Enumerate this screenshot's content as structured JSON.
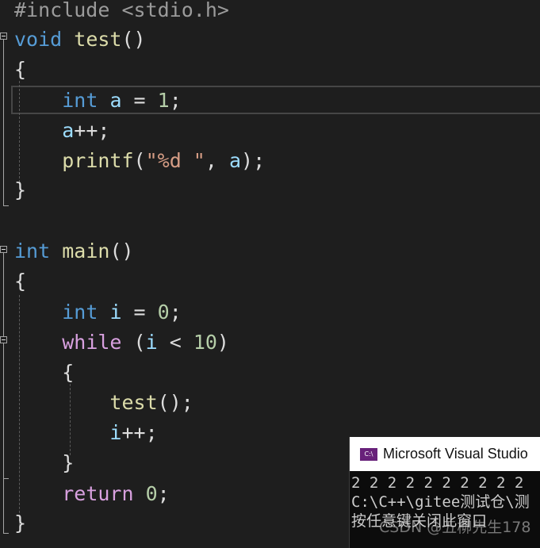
{
  "editor": {
    "lines": [
      {
        "id": "l0",
        "tokens": [
          {
            "t": "#include <stdio.h>",
            "c": "pre"
          }
        ]
      },
      {
        "id": "l1",
        "tokens": [
          {
            "t": "void",
            "c": "kw"
          },
          {
            "t": " ",
            "c": "plain"
          },
          {
            "t": "test",
            "c": "fn"
          },
          {
            "t": "()",
            "c": "plain"
          }
        ]
      },
      {
        "id": "l2",
        "tokens": [
          {
            "t": "{",
            "c": "plain"
          }
        ]
      },
      {
        "id": "l3",
        "tokens": [
          {
            "t": "    ",
            "c": "plain"
          },
          {
            "t": "int",
            "c": "kw"
          },
          {
            "t": " ",
            "c": "plain"
          },
          {
            "t": "a",
            "c": "var"
          },
          {
            "t": " = ",
            "c": "plain"
          },
          {
            "t": "1",
            "c": "num"
          },
          {
            "t": ";",
            "c": "plain"
          }
        ]
      },
      {
        "id": "l4",
        "tokens": [
          {
            "t": "    ",
            "c": "plain"
          },
          {
            "t": "a",
            "c": "var"
          },
          {
            "t": "++;",
            "c": "plain"
          }
        ]
      },
      {
        "id": "l5",
        "tokens": [
          {
            "t": "    ",
            "c": "plain"
          },
          {
            "t": "printf",
            "c": "fn"
          },
          {
            "t": "(",
            "c": "plain"
          },
          {
            "t": "\"%d \"",
            "c": "str"
          },
          {
            "t": ", ",
            "c": "plain"
          },
          {
            "t": "a",
            "c": "var"
          },
          {
            "t": ");",
            "c": "plain"
          }
        ]
      },
      {
        "id": "l6",
        "tokens": [
          {
            "t": "}",
            "c": "plain"
          }
        ]
      },
      {
        "id": "l7",
        "tokens": []
      },
      {
        "id": "l8",
        "tokens": [
          {
            "t": "int",
            "c": "kw"
          },
          {
            "t": " ",
            "c": "plain"
          },
          {
            "t": "main",
            "c": "fn"
          },
          {
            "t": "()",
            "c": "plain"
          }
        ]
      },
      {
        "id": "l9",
        "tokens": [
          {
            "t": "{",
            "c": "plain"
          }
        ]
      },
      {
        "id": "l10",
        "tokens": [
          {
            "t": "    ",
            "c": "plain"
          },
          {
            "t": "int",
            "c": "kw"
          },
          {
            "t": " ",
            "c": "plain"
          },
          {
            "t": "i",
            "c": "var"
          },
          {
            "t": " = ",
            "c": "plain"
          },
          {
            "t": "0",
            "c": "num"
          },
          {
            "t": ";",
            "c": "plain"
          }
        ]
      },
      {
        "id": "l11",
        "tokens": [
          {
            "t": "    ",
            "c": "plain"
          },
          {
            "t": "while",
            "c": "ctl"
          },
          {
            "t": " (",
            "c": "plain"
          },
          {
            "t": "i",
            "c": "var"
          },
          {
            "t": " < ",
            "c": "plain"
          },
          {
            "t": "10",
            "c": "num"
          },
          {
            "t": ")",
            "c": "plain"
          }
        ]
      },
      {
        "id": "l12",
        "tokens": [
          {
            "t": "    {",
            "c": "plain"
          }
        ]
      },
      {
        "id": "l13",
        "tokens": [
          {
            "t": "        ",
            "c": "plain"
          },
          {
            "t": "test",
            "c": "fn"
          },
          {
            "t": "();",
            "c": "plain"
          }
        ]
      },
      {
        "id": "l14",
        "tokens": [
          {
            "t": "        ",
            "c": "plain"
          },
          {
            "t": "i",
            "c": "var"
          },
          {
            "t": "++;",
            "c": "plain"
          }
        ]
      },
      {
        "id": "l15",
        "tokens": [
          {
            "t": "    }",
            "c": "plain"
          }
        ]
      },
      {
        "id": "l16",
        "tokens": [
          {
            "t": "    ",
            "c": "plain"
          },
          {
            "t": "return",
            "c": "ctl"
          },
          {
            "t": " ",
            "c": "plain"
          },
          {
            "t": "0",
            "c": "num"
          },
          {
            "t": ";",
            "c": "plain"
          }
        ]
      },
      {
        "id": "l17",
        "tokens": [
          {
            "t": "}",
            "c": "plain"
          }
        ]
      }
    ]
  },
  "console": {
    "title": "Microsoft Visual Studio",
    "icon_text": "C:\\",
    "output": "2 2 2 2 2 2 2 2 2 2",
    "path": "C:\\C++\\gitee测试仓\\测",
    "prompt": "按任意键关闭此窗口"
  },
  "watermark": "CSDN @五柳先生178",
  "colors": {
    "background": "#1e1e1e",
    "keyword": "#569cd6",
    "control": "#d8a0df",
    "function": "#dcdcaa",
    "number": "#b5cea8",
    "variable": "#9cdcfe",
    "string": "#d69d85",
    "preprocessor": "#9b9b9b",
    "console_bg": "#0c0c0c",
    "console_icon": "#68217a"
  }
}
